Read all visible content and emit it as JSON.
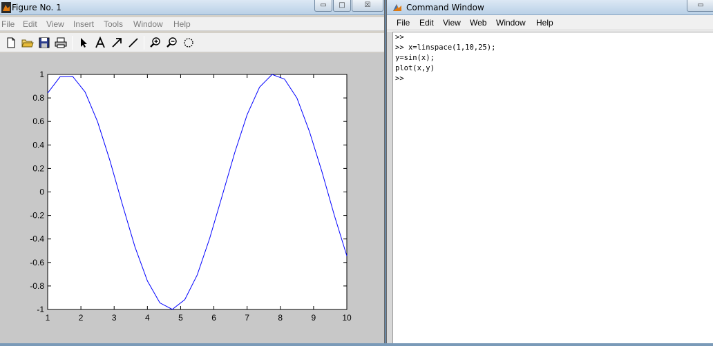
{
  "figure_window": {
    "title": "Figure No. 1",
    "controls": {
      "minimize": "▭",
      "maximize": "□",
      "close": "☒"
    },
    "menu": [
      "File",
      "Edit",
      "View",
      "Insert",
      "Tools",
      "Window",
      "Help"
    ],
    "toolbar_icons": [
      "new-file-icon",
      "open-folder-icon",
      "save-icon",
      "print-icon",
      "select-arrow-icon",
      "text-icon",
      "arrow-icon",
      "line-icon",
      "zoom-in-icon",
      "zoom-out-icon",
      "rotate-icon"
    ]
  },
  "command_window": {
    "title": "Command Window",
    "menu": [
      "File",
      "Edit",
      "View",
      "Web",
      "Window",
      "Help"
    ],
    "lines": [
      ">>",
      ">> x=linspace(1,10,25);",
      "y=sin(x);",
      "plot(x,y)",
      ">>"
    ]
  },
  "colors": {
    "line": "#0000ff",
    "axes_bg": "#ffffff",
    "figure_bg": "#c8c8c8"
  },
  "chart_data": {
    "type": "line",
    "x": [
      1,
      1.375,
      1.75,
      2.125,
      2.5,
      2.875,
      3.25,
      3.625,
      4,
      4.375,
      4.75,
      5.125,
      5.5,
      5.875,
      6.25,
      6.625,
      7,
      7.375,
      7.75,
      8.125,
      8.5,
      8.875,
      9.25,
      9.625,
      10
    ],
    "y": [
      0.8415,
      0.9808,
      0.984,
      0.8509,
      0.5985,
      0.2649,
      -0.1082,
      -0.4665,
      -0.7568,
      -0.9439,
      -0.9993,
      -0.9165,
      -0.7055,
      -0.3938,
      -0.0332,
      0.3323,
      0.657,
      0.892,
      0.9995,
      0.9605,
      0.7985,
      0.5145,
      0.1733,
      -0.1995,
      -0.544
    ],
    "xlim": [
      1,
      10
    ],
    "ylim": [
      -1,
      1
    ],
    "xticks": [
      1,
      2,
      3,
      4,
      5,
      6,
      7,
      8,
      9,
      10
    ],
    "yticks": [
      1,
      0.8,
      0.6,
      0.4,
      0.2,
      0,
      -0.2,
      -0.4,
      -0.6,
      -0.8,
      -1
    ],
    "title": "",
    "xlabel": "",
    "ylabel": "",
    "grid": false
  }
}
